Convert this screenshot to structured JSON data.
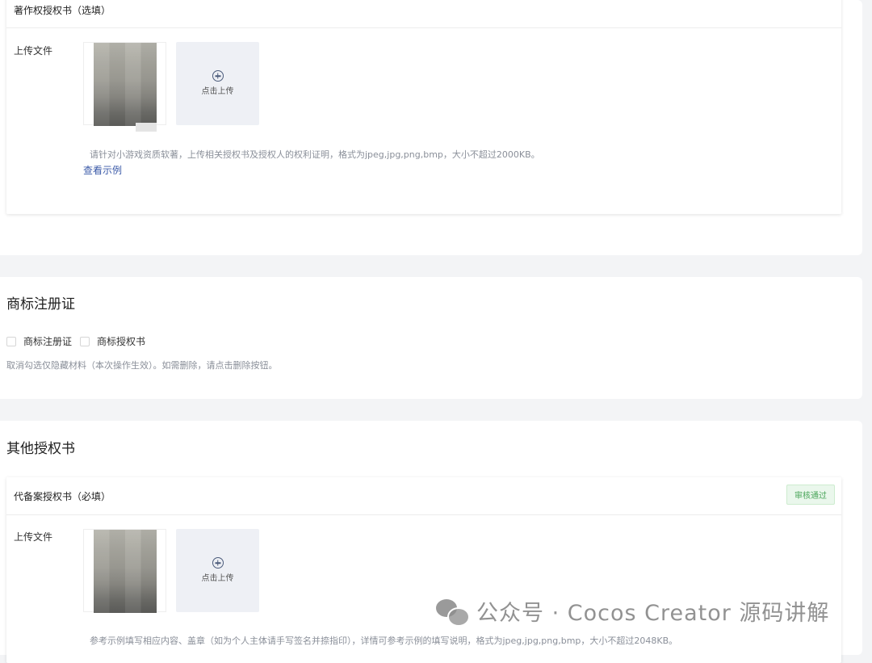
{
  "copyright_section": {
    "card": {
      "title": "著作权授权书（选填）",
      "upload_label": "上传文件",
      "upload_button_text": "点击上传",
      "hint": "请针对小游戏资质软著，上传相关授权书及授权人的权利证明，格式为jpeg,jpg,png,bmp，大小不超过2000KB。",
      "example_link": "查看示例"
    }
  },
  "trademark_section": {
    "title": "商标注册证",
    "checkboxes": [
      {
        "label": "商标注册证",
        "checked": false
      },
      {
        "label": "商标授权书",
        "checked": false
      }
    ],
    "hint": "取消勾选仅隐藏材料（本次操作生效）。如需删除，请点击删除按钮。"
  },
  "other_section": {
    "title": "其他授权书",
    "card": {
      "title": "代备案授权书（必填）",
      "status_badge": "审核通过",
      "upload_label": "上传文件",
      "upload_button_text": "点击上传",
      "hint": "参考示例填写相应内容、盖章（如为个人主体请手写签名并捺指印），详情可参考示例的填写说明，格式为jpeg,jpg,png,bmp，大小不超过2048KB。"
    }
  },
  "watermark": {
    "text": "公众号 · Cocos Creator 源码讲解"
  },
  "colors": {
    "link": "#3b5aa8",
    "success": "#4aa55a",
    "hint": "#8a8f99"
  }
}
